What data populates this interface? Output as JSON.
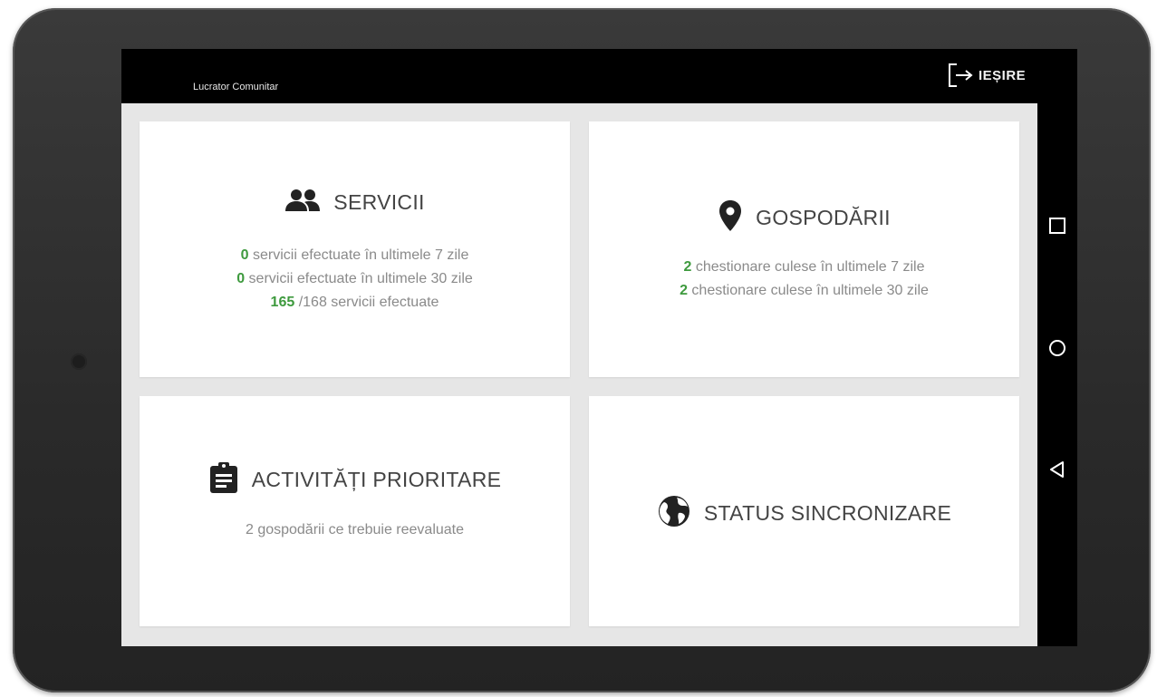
{
  "app": {
    "title": "Lucrator Comunitar",
    "exit_label": "IEȘIRE"
  },
  "colors": {
    "accent_green": "#3e9a3e",
    "appbar": "#000000",
    "content_bg": "#e6e6e6",
    "card_bg": "#ffffff"
  },
  "cards": {
    "servicii": {
      "title": "SERVICII",
      "icon": "people-icon",
      "lines": [
        {
          "num": "0",
          "text": " servicii efectuate în ultimele 7 zile"
        },
        {
          "num": "0",
          "text": " servicii efectuate în ultimele 30 zile"
        },
        {
          "num": "165",
          "text": " /168 servicii efectuate"
        }
      ]
    },
    "gospodarii": {
      "title": "GOSPODĂRII",
      "icon": "location-pin-icon",
      "lines": [
        {
          "num": "2",
          "text": " chestionare culese în ultimele 7 zile"
        },
        {
          "num": "2",
          "text": " chestionare culese în ultimele 30 zile"
        }
      ]
    },
    "activitati": {
      "title": "ACTIVITĂȚI PRIORITARE",
      "icon": "clipboard-icon",
      "subtitle": "2 gospodării ce trebuie reevaluate"
    },
    "status": {
      "title": "STATUS SINCRONIZARE",
      "icon": "globe-icon"
    }
  },
  "system_nav": {
    "recents": "square-icon",
    "home": "circle-icon",
    "back": "triangle-back-icon"
  }
}
